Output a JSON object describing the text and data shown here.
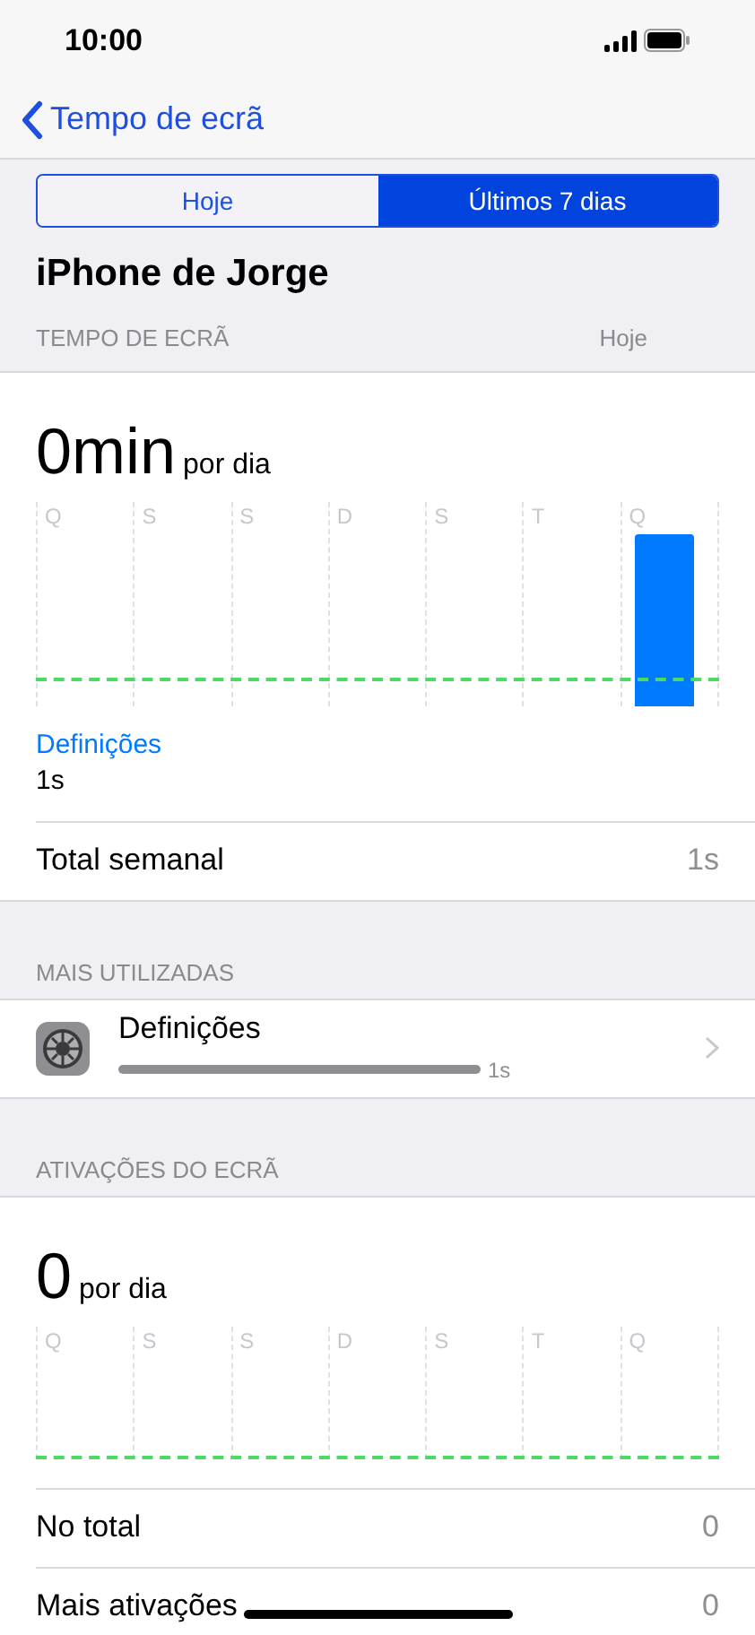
{
  "status_bar": {
    "time": "10:00"
  },
  "nav": {
    "back_label": "Tempo de ecrã"
  },
  "segments": [
    {
      "label": "Hoje",
      "selected": false
    },
    {
      "label": "Últimos 7 dias",
      "selected": true
    }
  ],
  "device_title": "iPhone de Jorge",
  "screen_time": {
    "header": "TEMPO DE ECRÃ",
    "header_right": "Hoje",
    "value": "0min",
    "unit": "por dia",
    "days": [
      {
        "label": "Q",
        "has_usage": false
      },
      {
        "label": "S",
        "has_usage": false
      },
      {
        "label": "S",
        "has_usage": false
      },
      {
        "label": "D",
        "has_usage": false
      },
      {
        "label": "S",
        "has_usage": false
      },
      {
        "label": "T",
        "has_usage": false
      },
      {
        "label": "Q",
        "has_usage": true
      }
    ],
    "category": "Definições",
    "category_value": "1s",
    "total_label": "Total semanal",
    "total_value": "1s"
  },
  "most_used": {
    "header": "MAIS UTILIZADAS",
    "apps": [
      {
        "name": "Definições",
        "time": "1s"
      }
    ]
  },
  "pickups": {
    "header": "ATIVAÇÕES DO ECRÃ",
    "value": "0",
    "unit": "por dia",
    "days": [
      {
        "label": "Q"
      },
      {
        "label": "S"
      },
      {
        "label": "S"
      },
      {
        "label": "D"
      },
      {
        "label": "S"
      },
      {
        "label": "T"
      },
      {
        "label": "Q"
      }
    ],
    "rows": [
      {
        "label": "No total",
        "value": "0"
      },
      {
        "label": "Mais ativações",
        "value": "0"
      }
    ]
  }
}
